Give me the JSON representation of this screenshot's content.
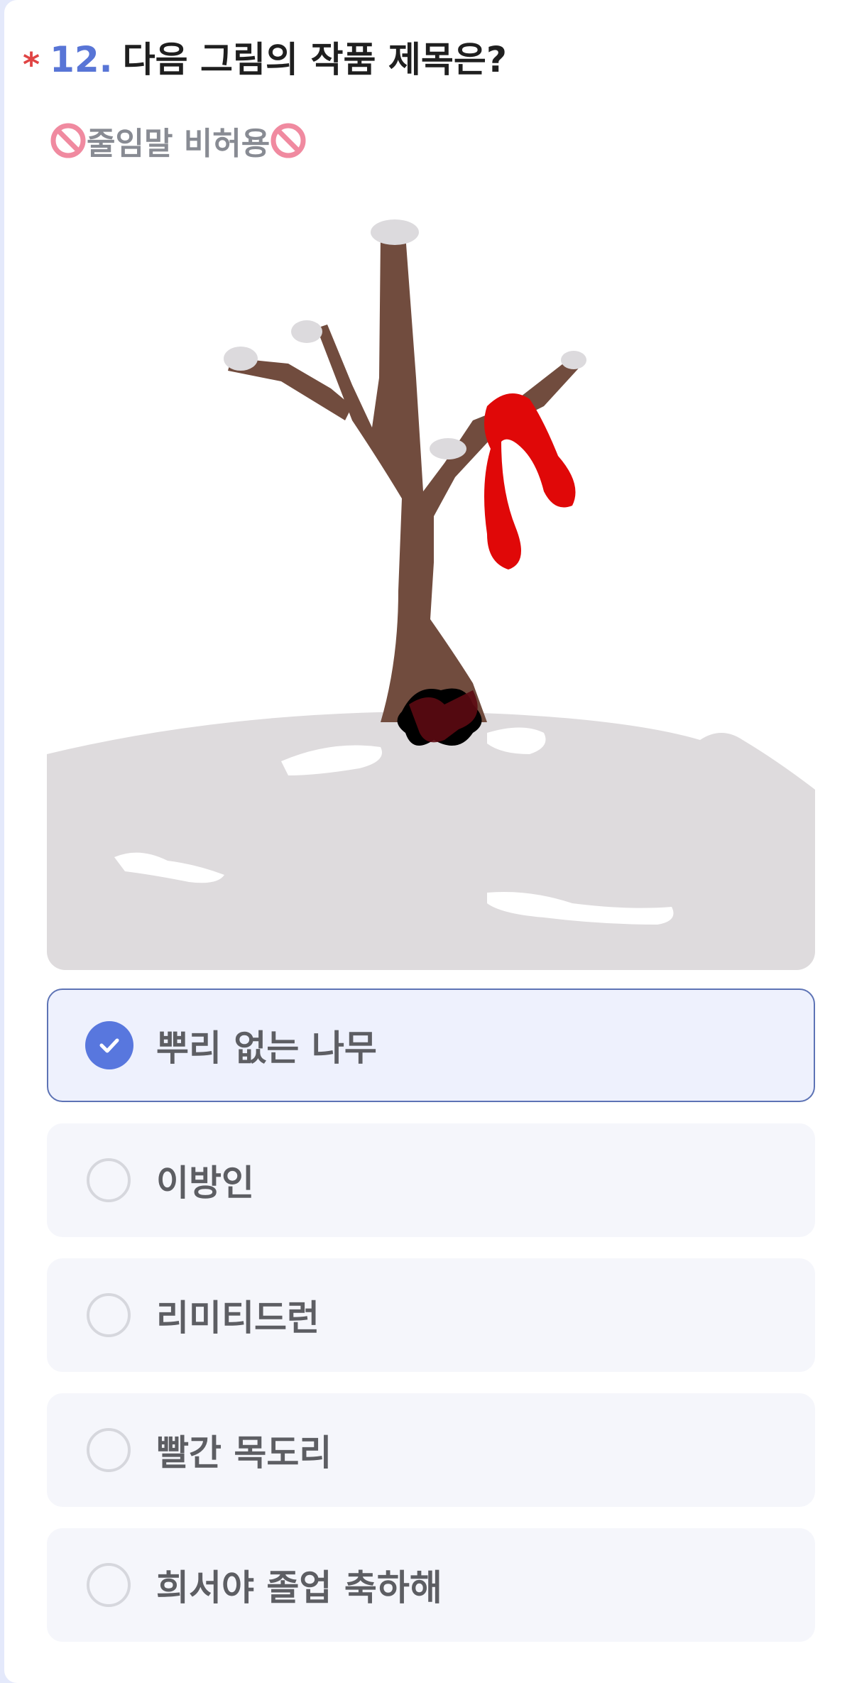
{
  "question": {
    "required_mark": "*",
    "number": "12.",
    "title": "다음 그림의 작품 제목은?",
    "subtitle": "줄임말 비허용",
    "subtitle_icons": [
      "prohibited-icon",
      "prohibited-icon"
    ],
    "image": {
      "description_icon": "snowy-tree-with-red-scarf-illustration"
    }
  },
  "options": [
    {
      "label": "뿌리 없는 나무",
      "selected": true
    },
    {
      "label": "이방인",
      "selected": false
    },
    {
      "label": "리미티드런",
      "selected": false
    },
    {
      "label": "빨간 목도리",
      "selected": false
    },
    {
      "label": "희서야 졸업 축하해",
      "selected": false
    }
  ],
  "colors": {
    "accent": "#5877de",
    "question_number": "#5875d6",
    "required": "#e04444",
    "option_bg": "#f5f6fb",
    "selected_bg": "#eef1fd",
    "selected_border": "#5d73b5"
  }
}
